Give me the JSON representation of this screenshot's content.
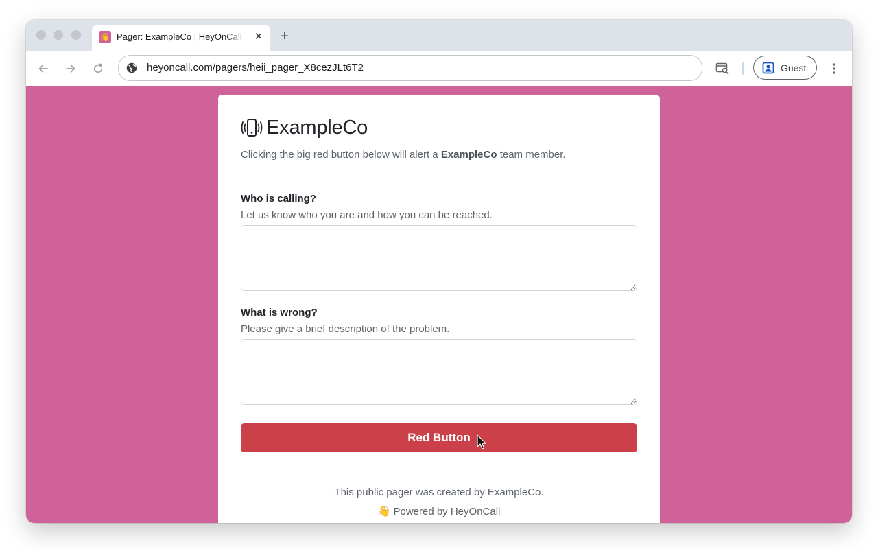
{
  "browser": {
    "tab": {
      "favicon": "waving-hand-icon",
      "favicon_glyph": "👋",
      "title": "Pager: ExampleCo | HeyOnCall",
      "close_glyph": "✕"
    },
    "new_tab_glyph": "+",
    "address": "heyoncall.com/pagers/heii_pager_X8cezJLt6T2",
    "profile_label": "Guest"
  },
  "page": {
    "background_color": "#cf6399",
    "brand": {
      "icon": "vibrating-phone-icon",
      "name": "ExampleCo"
    },
    "intro": {
      "before": "Clicking the big red button below will alert a ",
      "org": "ExampleCo",
      "after": " team member."
    },
    "who": {
      "label": "Who is calling?",
      "help": "Let us know who you are and how you can be reached.",
      "value": ""
    },
    "what": {
      "label": "What is wrong?",
      "help": "Please give a brief description of the problem.",
      "value": ""
    },
    "button": {
      "label": "Red Button",
      "color": "#cc4149"
    },
    "footer": {
      "created_by": "This public pager was created by ExampleCo.",
      "powered_icon": "waving-hand-icon",
      "powered_glyph": "👋",
      "powered_by": "Powered by HeyOnCall"
    }
  }
}
